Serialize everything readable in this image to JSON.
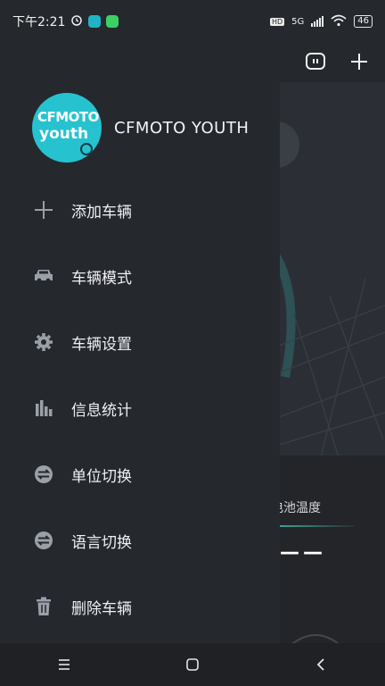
{
  "status_bar": {
    "time": "下午2:21",
    "network": "5G",
    "hd": "HD",
    "battery": "46"
  },
  "drawer": {
    "profile": {
      "avatar_line1": "CFMOTO",
      "avatar_line2": "youth",
      "name": "CFMOTO YOUTH"
    },
    "menu": [
      {
        "label": "添加车辆",
        "icon": "plus-icon"
      },
      {
        "label": "车辆模式",
        "icon": "car-icon"
      },
      {
        "label": "车辆设置",
        "icon": "gear-icon"
      },
      {
        "label": "信息统计",
        "icon": "bar-chart-icon"
      },
      {
        "label": "单位切换",
        "icon": "swap-icon"
      },
      {
        "label": "语言切换",
        "icon": "swap-icon"
      },
      {
        "label": "删除车辆",
        "icon": "trash-icon"
      }
    ]
  },
  "background_app": {
    "battery_temp_label": "电池温度",
    "battery_temp_value": "——"
  },
  "colors": {
    "accent": "#26c2cf",
    "drawer_bg": "#25282d"
  }
}
